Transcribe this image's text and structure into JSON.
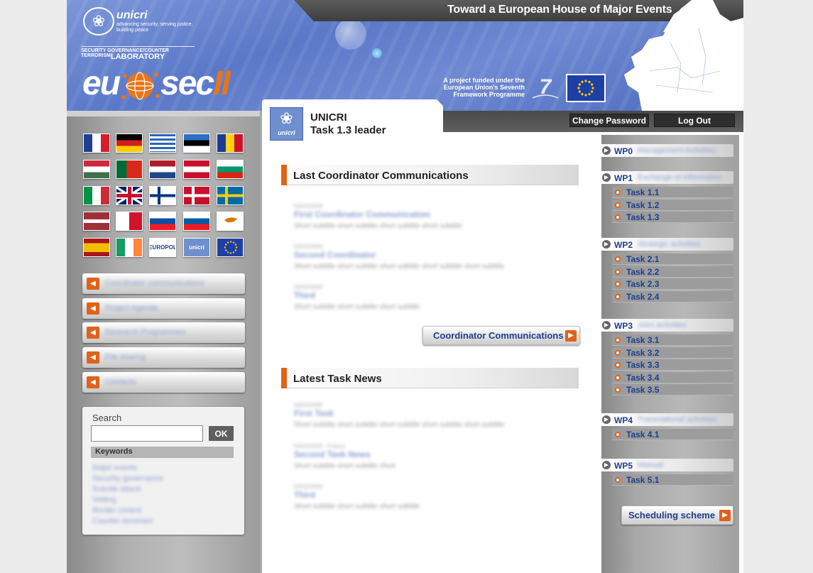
{
  "header": {
    "title": "Toward a European House of Major Events",
    "logo_name": "unicri",
    "logo_tagline": "advancing security, serving justice, building peace",
    "logo_sub": "SECURITY GOVERNANCE/COUNTER TERRORISM",
    "logo_lab": "LABORATORY",
    "brand_main": "eu",
    "brand_mid": "sec",
    "brand_ii": "II",
    "funding_text": "A project funded under the European Union's Seventh Framework Programme",
    "fp7_icon": "fp7-logo",
    "eu_flag_icon": "eu-flag",
    "colors": {
      "accent": "#e0621a",
      "link": "#1e3f8c",
      "header_blue": "#5a78c8"
    }
  },
  "account": {
    "change_password": "Change Password",
    "log_out": "Log Out"
  },
  "tab": {
    "logo_text": "unicri",
    "org": "UNICRI",
    "role": "Task 1.3 leader"
  },
  "flags": [
    {
      "name": "france",
      "colors": [
        "#1f3f94",
        "#ffffff",
        "#d61e2b"
      ],
      "dir": "v"
    },
    {
      "name": "germany",
      "colors": [
        "#000000",
        "#d61e1e",
        "#ffcc00"
      ],
      "dir": "h"
    },
    {
      "name": "greece",
      "colors": [
        "#2a64b8",
        "#ffffff"
      ],
      "dir": "stripes"
    },
    {
      "name": "estonia",
      "colors": [
        "#2e6fc4",
        "#000000",
        "#ffffff"
      ],
      "dir": "h"
    },
    {
      "name": "romania",
      "colors": [
        "#1d3a94",
        "#fcd116",
        "#ce1126"
      ],
      "dir": "v"
    },
    {
      "name": "hungary",
      "colors": [
        "#cd2a3e",
        "#ffffff",
        "#436f4d"
      ],
      "dir": "h"
    },
    {
      "name": "portugal",
      "colors": [
        "#046a38",
        "#da291c"
      ],
      "dir": "pt"
    },
    {
      "name": "netherlands",
      "colors": [
        "#ae1c28",
        "#ffffff",
        "#21468b"
      ],
      "dir": "h"
    },
    {
      "name": "austria",
      "colors": [
        "#c8102e",
        "#ffffff",
        "#c8102e"
      ],
      "dir": "h"
    },
    {
      "name": "bulgaria",
      "colors": [
        "#ffffff",
        "#00966e",
        "#d62612"
      ],
      "dir": "h"
    },
    {
      "name": "italy",
      "colors": [
        "#009246",
        "#ffffff",
        "#ce2b37"
      ],
      "dir": "v"
    },
    {
      "name": "united-kingdom",
      "colors": [
        "#012169",
        "#ffffff",
        "#c8102e"
      ],
      "dir": "uk"
    },
    {
      "name": "finland",
      "colors": [
        "#ffffff",
        "#003580"
      ],
      "dir": "nordic"
    },
    {
      "name": "denmark",
      "colors": [
        "#c8102e",
        "#ffffff"
      ],
      "dir": "nordic"
    },
    {
      "name": "sweden",
      "colors": [
        "#006aa7",
        "#fecc00"
      ],
      "dir": "nordic"
    },
    {
      "name": "latvia",
      "colors": [
        "#9e3039",
        "#ffffff",
        "#9e3039"
      ],
      "dir": "lv"
    },
    {
      "name": "malta",
      "colors": [
        "#ffffff",
        "#cf142b"
      ],
      "dir": "v2"
    },
    {
      "name": "slovakia",
      "colors": [
        "#ffffff",
        "#0b4ea2",
        "#ee1c25"
      ],
      "dir": "h"
    },
    {
      "name": "slovenia",
      "colors": [
        "#ffffff",
        "#005da4",
        "#ed1c24"
      ],
      "dir": "h"
    },
    {
      "name": "cyprus",
      "colors": [
        "#ffffff",
        "#d57800"
      ],
      "dir": "cy"
    },
    {
      "name": "spain",
      "colors": [
        "#aa151b",
        "#f1bf00",
        "#aa151b"
      ],
      "dir": "es"
    },
    {
      "name": "ireland",
      "colors": [
        "#169b62",
        "#ffffff",
        "#ff883e"
      ],
      "dir": "v"
    },
    {
      "name": "europol",
      "colors": [
        "#ffffff",
        "#1e3f8c"
      ],
      "dir": "text",
      "label": "EUROPOL"
    },
    {
      "name": "unicri",
      "colors": [
        "#6f8fcf",
        "#ffffff"
      ],
      "dir": "text",
      "label": "unicri"
    },
    {
      "name": "european-union",
      "colors": [
        "#1e3fa6",
        "#ffcc00"
      ],
      "dir": "eu"
    }
  ],
  "left_nav": [
    {
      "label": "Coordinator communications"
    },
    {
      "label": "Project Agenda"
    },
    {
      "label": "Research Programmes"
    },
    {
      "label": "File sharing"
    },
    {
      "label": "Contacts"
    }
  ],
  "search": {
    "label": "Search",
    "value": "",
    "button": "OK",
    "keywords_label": "Keywords",
    "keywords": [
      "Major events",
      "Security governance",
      "Suicide attack",
      "Vetting",
      "Border control",
      "Counter terrorism"
    ]
  },
  "coord": {
    "heading": "Last Coordinator Communications",
    "items": [
      {
        "date": "04/03/2009",
        "title": "First Coordinator Communication",
        "sub": "Short subtitle short subtitle short subtitle short subtitle"
      },
      {
        "date": "04/03/2009",
        "title": "Second Coordinator",
        "sub": "Short subtitle short subtitle short subtitle short subtitle short subtitle"
      },
      {
        "date": "04/03/2009",
        "title": "Third",
        "sub": "Short subtitle short subtitle short subtitle"
      }
    ],
    "button": "Coordinator Communications"
  },
  "news": {
    "heading": "Latest Task News",
    "items": [
      {
        "date": "04/03/2009",
        "title": "First Task",
        "sub": "Short subtitle short subtitle short subtitle short subtitle short subtitle"
      },
      {
        "date": "04/03/2009 - France",
        "title": "Second Task News",
        "sub": "Short subtitle short subtitle short"
      },
      {
        "date": "04/03/2009",
        "title": "Third",
        "sub": "Short subtitle short subtitle short subtitle"
      }
    ]
  },
  "work_packages": [
    {
      "code": "WP0",
      "name": "Management Activities",
      "tasks": []
    },
    {
      "code": "WP1",
      "name": "Exchange of information",
      "tasks": [
        "Task 1.1",
        "Task 1.2",
        "Task 1.3"
      ]
    },
    {
      "code": "WP2",
      "name": "Strategic activities",
      "tasks": [
        "Task 2.1",
        "Task 2.2",
        "Task 2.3",
        "Task 2.4"
      ]
    },
    {
      "code": "WP3",
      "name": "Joint activities",
      "tasks": [
        "Task 3.1",
        "Task 3.2",
        "Task 3.3",
        "Task 3.4",
        "Task 3.5"
      ]
    },
    {
      "code": "WP4",
      "name": "Transnational activities",
      "tasks": [
        "Task 4.1"
      ]
    },
    {
      "code": "WP5",
      "name": "Manual",
      "tasks": [
        "Task 5.1"
      ]
    }
  ],
  "scheduling_button": "Scheduling scheme"
}
